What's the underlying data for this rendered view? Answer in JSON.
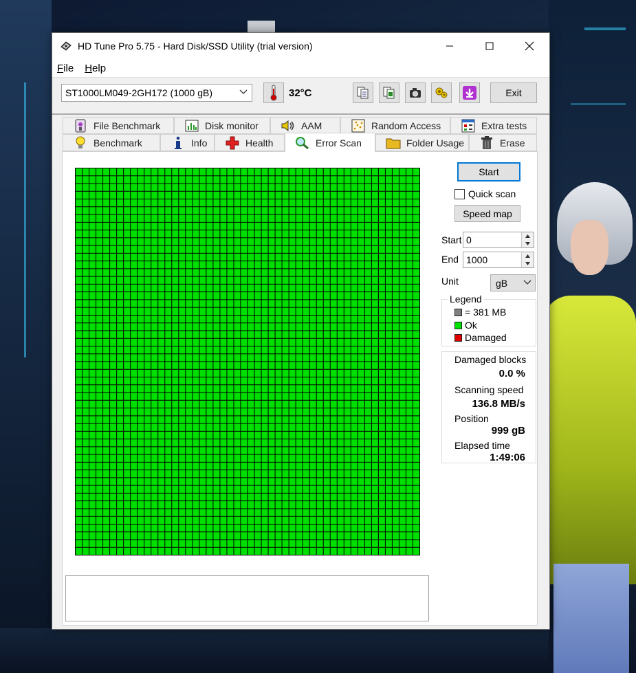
{
  "window": {
    "title": "HD Tune Pro 5.75 - Hard Disk/SSD Utility (trial version)",
    "controls": [
      "minimize",
      "maximize",
      "close"
    ]
  },
  "menu": {
    "file_underlined": "F",
    "file_rest": "ile",
    "help_underlined": "H",
    "help_rest": "elp"
  },
  "toolbar": {
    "drive": "ST1000LM049-2GH172 (1000 gB)",
    "temperature": "32°C",
    "exit_label": "Exit",
    "icons": [
      "copy-info-icon",
      "copy-screen-icon",
      "camera-icon",
      "options-icon",
      "download-icon"
    ]
  },
  "tabs": {
    "row1": [
      {
        "label": "File Benchmark",
        "icon": "file-benchmark-icon"
      },
      {
        "label": "Disk monitor",
        "icon": "disk-monitor-icon"
      },
      {
        "label": "AAM",
        "icon": "speaker-icon"
      },
      {
        "label": "Random Access",
        "icon": "random-access-icon"
      },
      {
        "label": "Extra tests",
        "icon": "extra-tests-icon"
      }
    ],
    "row2": [
      {
        "label": "Benchmark",
        "icon": "bulb-icon"
      },
      {
        "label": "Info",
        "icon": "info-icon"
      },
      {
        "label": "Health",
        "icon": "health-cross-icon"
      },
      {
        "label": "Error Scan",
        "icon": "magnifier-icon"
      },
      {
        "label": "Folder Usage",
        "icon": "folder-icon"
      },
      {
        "label": "Erase",
        "icon": "trash-icon"
      }
    ],
    "active": "Error Scan"
  },
  "error_scan": {
    "grid": {
      "cols": 50,
      "rows": 50,
      "ok_color": "#00e000",
      "line_color": "#000000",
      "damaged_blocks": 0
    },
    "start_button": "Start",
    "quick_scan_label": "Quick scan",
    "quick_scan_checked": false,
    "speed_map_button": "Speed map",
    "start_label": "Start",
    "start_value": "0",
    "end_label": "End",
    "end_value": "1000",
    "unit_label": "Unit",
    "unit_value": "gB",
    "legend": {
      "title": "Legend",
      "block_size": "= 381 MB",
      "ok": "Ok",
      "damaged": "Damaged",
      "colors": {
        "block": "#808080",
        "ok": "#00e000",
        "damaged": "#e00000"
      }
    },
    "stats": {
      "damaged_blocks_label": "Damaged blocks",
      "damaged_blocks_value": "0.0 %",
      "scanning_speed_label": "Scanning speed",
      "scanning_speed_value": "136.8 MB/s",
      "position_label": "Position",
      "position_value": "999 gB",
      "elapsed_label": "Elapsed time",
      "elapsed_value": "1:49:06"
    }
  }
}
